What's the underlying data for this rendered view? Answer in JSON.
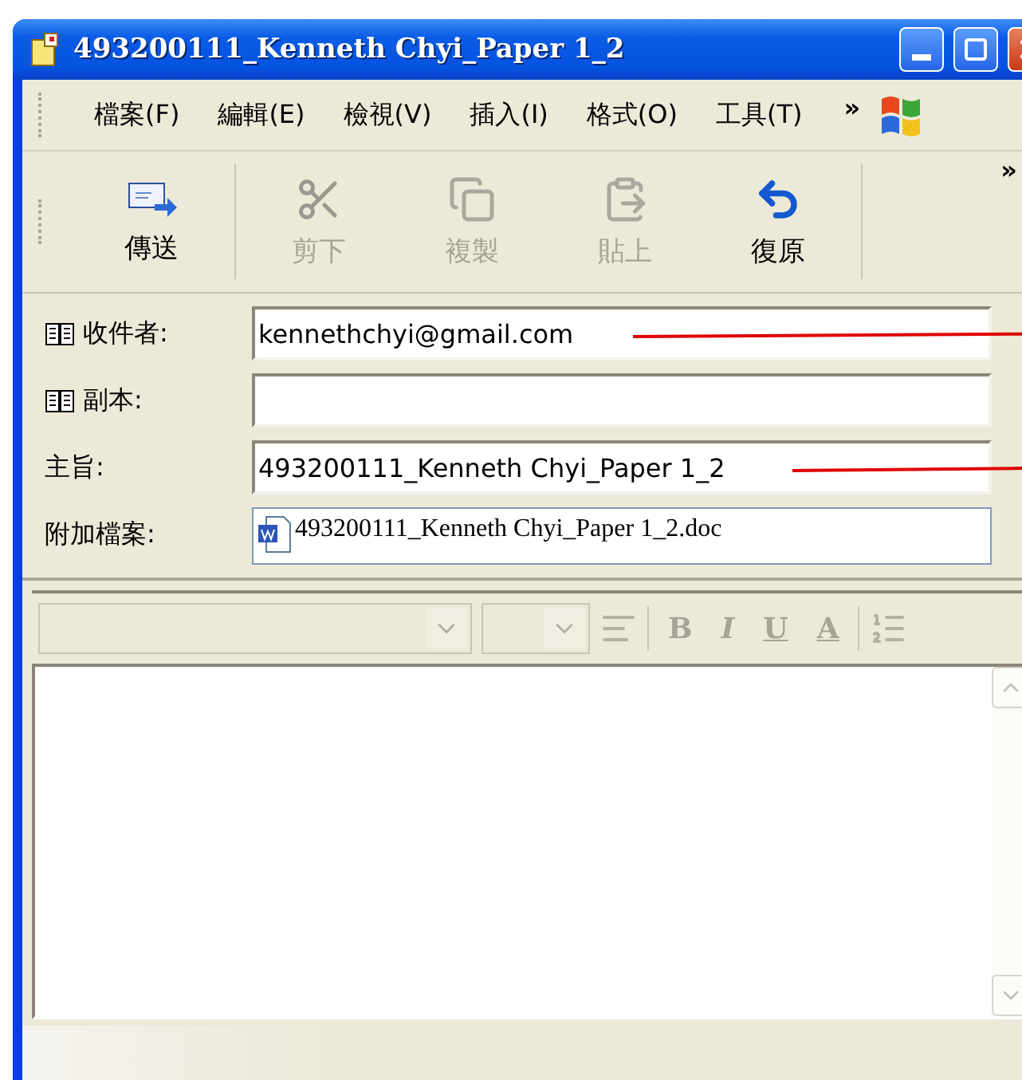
{
  "window": {
    "title": "493200111_Kenneth Chyi_Paper 1_2"
  },
  "menu": [
    "檔案(F)",
    "編輯(E)",
    "檢視(V)",
    "插入(I)",
    "格式(O)",
    "工具(T)"
  ],
  "menu_overflow": "»",
  "toolbar": [
    {
      "kind": "send",
      "label": "傳送",
      "disabled": false
    },
    {
      "kind": "cut",
      "label": "剪下",
      "disabled": true
    },
    {
      "kind": "copy",
      "label": "複製",
      "disabled": true
    },
    {
      "kind": "paste",
      "label": "貼上",
      "disabled": true
    },
    {
      "kind": "undo",
      "label": "復原",
      "disabled": false
    }
  ],
  "toolbar_overflow": "»",
  "fields": [
    {
      "kind": "address",
      "label": "收件者:",
      "value": "kennethchyi@gmail.com",
      "annotated": true
    },
    {
      "kind": "address",
      "label": "副本:",
      "annotated": false
    },
    {
      "kind": "text",
      "label": "主旨:",
      "value": "493200111_Kenneth Chyi_Paper 1_2",
      "annotated": true
    },
    {
      "kind": "attachment",
      "label": "附加檔案:",
      "value": "493200111_Kenneth Chyi_Paper 1_2.doc",
      "annotated": false
    }
  ],
  "format_bar": [
    {
      "kind": "font",
      "disabled": true
    },
    {
      "kind": "size",
      "disabled": true
    },
    {
      "kind": "paragraph",
      "disabled": true
    },
    {
      "kind": "bold",
      "label": "B",
      "disabled": true
    },
    {
      "kind": "italic",
      "label": "I",
      "disabled": true
    },
    {
      "kind": "underline",
      "label": "U",
      "disabled": true
    },
    {
      "kind": "color",
      "label": "A",
      "disabled": true
    },
    {
      "kind": "list",
      "disabled": true
    }
  ]
}
